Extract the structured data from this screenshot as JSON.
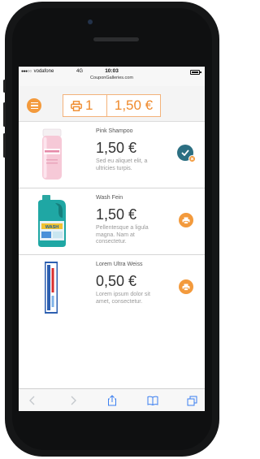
{
  "status_bar": {
    "signal": "●●●○○",
    "carrier": "vodafone",
    "network": "4G",
    "time": "10:03",
    "url": "CouponGalleries.com"
  },
  "cart": {
    "count": "1",
    "total": "1,50 €"
  },
  "products": [
    {
      "name": "Pink Shampoo",
      "price": "1,50 €",
      "description": "Sed eu aliquet elit, a ultricies turpis.",
      "state": "selected",
      "image": "pink-shampoo-bottle"
    },
    {
      "name": "Wash Fein",
      "price": "1,50 €",
      "description": "Pellentesque a ligula magna. Nam at consectetur.",
      "state": "printable",
      "image": "detergent-bottle"
    },
    {
      "name": "Lorem Ultra Weiss",
      "price": "0,50 €",
      "description": "Lorem ipsum dolor sit amet, consectetur.",
      "state": "printable",
      "image": "toothpaste-box"
    }
  ],
  "colors": {
    "accent": "#f39a3c",
    "selected": "#2c6f82"
  },
  "icons": {
    "menu": "menu-icon",
    "cart_printer": "printer-icon",
    "item_print": "printer-icon",
    "item_selected": "check-icon",
    "toolbar": [
      "back-icon",
      "forward-icon",
      "share-icon",
      "bookmarks-icon",
      "tabs-icon"
    ]
  }
}
